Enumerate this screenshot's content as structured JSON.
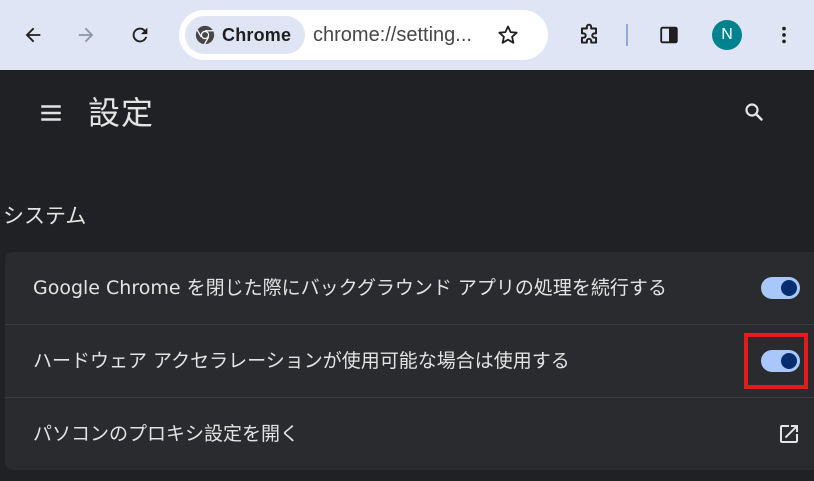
{
  "browser": {
    "site_chip_label": "Chrome",
    "url": "chrome://setting...",
    "profile_initial": "N",
    "icons": {
      "back": "arrow-left-icon",
      "forward": "arrow-right-icon",
      "reload": "reload-icon",
      "site": "chrome-logo-icon",
      "bookmark": "star-icon",
      "extensions": "puzzle-icon",
      "side_panel": "side-panel-icon",
      "menu": "more-vert-icon"
    }
  },
  "settings": {
    "title": "設定",
    "section_title": "システム",
    "rows": [
      {
        "label": "Google Chrome を閉じた際にバックグラウンド アプリの処理を続行する",
        "control": "toggle",
        "enabled": true
      },
      {
        "label": "ハードウェア アクセラレーションが使用可能な場合は使用する",
        "control": "toggle",
        "enabled": true,
        "highlighted": true
      },
      {
        "label": "パソコンのプロキシ設定を開く",
        "control": "external-link"
      }
    ]
  },
  "colors": {
    "toolbar_bg": "#dfe5f5",
    "page_bg": "#202124",
    "card_bg": "#2a2b2e",
    "toggle_track": "#a8c7fa",
    "toggle_knob": "#062e6f",
    "highlight": "#e41b1b",
    "avatar_bg": "#00838f"
  }
}
